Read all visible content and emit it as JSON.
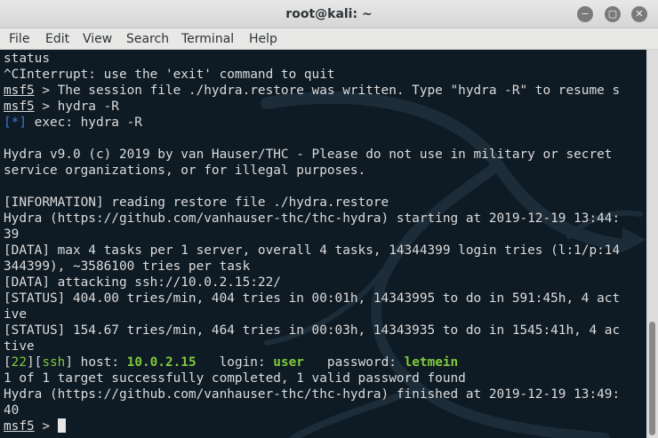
{
  "window": {
    "title": "root@kali: ~",
    "buttons": {
      "minimize": "−",
      "maximize": "▢",
      "close": "✕"
    }
  },
  "menu": [
    "File",
    "Edit",
    "View",
    "Search",
    "Terminal",
    "Help"
  ],
  "terminal": {
    "lines": [
      {
        "text": "status"
      },
      {
        "text": "^CInterrupt: use the 'exit' command to quit"
      },
      {
        "prompt": "msf5",
        "text": " > The session file ./hydra.restore was written. Type \"hydra -R\" to resume s"
      },
      {
        "prompt": "msf5",
        "text": " > hydra -R"
      },
      {
        "star": "[*]",
        "text": " exec: hydra -R"
      },
      {
        "text": ""
      },
      {
        "text": "Hydra v9.0 (c) 2019 by van Hauser/THC - Please do not use in military or secret"
      },
      {
        "text": "service organizations, or for illegal purposes."
      },
      {
        "text": ""
      },
      {
        "text": "[INFORMATION] reading restore file ./hydra.restore"
      },
      {
        "text": "Hydra (https://github.com/vanhauser-thc/thc-hydra) starting at 2019-12-19 13:44:"
      },
      {
        "text": "39"
      },
      {
        "text": "[DATA] max 4 tasks per 1 server, overall 4 tasks, 14344399 login tries (l:1/p:14"
      },
      {
        "text": "344399), ~3586100 tries per task"
      },
      {
        "text": "[DATA] attacking ssh://10.0.2.15:22/"
      },
      {
        "text": "[STATUS] 404.00 tries/min, 404 tries in 00:01h, 14343995 to do in 591:45h, 4 act"
      },
      {
        "text": "ive"
      },
      {
        "text": "[STATUS] 154.67 tries/min, 464 tries in 00:03h, 14343935 to do in 1545:41h, 4 ac"
      },
      {
        "text": "tive"
      },
      {
        "result": {
          "port": "22",
          "service": "ssh",
          "host_label": " host: ",
          "host": "10.0.2.15",
          "login_label": "   login: ",
          "login": "user",
          "password_label": "   password: ",
          "password": "letmein"
        }
      },
      {
        "text": "1 of 1 target successfully completed, 1 valid password found"
      },
      {
        "text": "Hydra (https://github.com/vanhauser-thc/thc-hydra) finished at 2019-12-19 13:49:"
      },
      {
        "text": "40"
      },
      {
        "prompt": "msf5",
        "text": " > ",
        "cursor": true
      }
    ]
  },
  "colors": {
    "background": "#0e1a24",
    "text": "#dcdcdc",
    "accent_green": "#7ec93a",
    "accent_blue": "#3b7ad9"
  }
}
